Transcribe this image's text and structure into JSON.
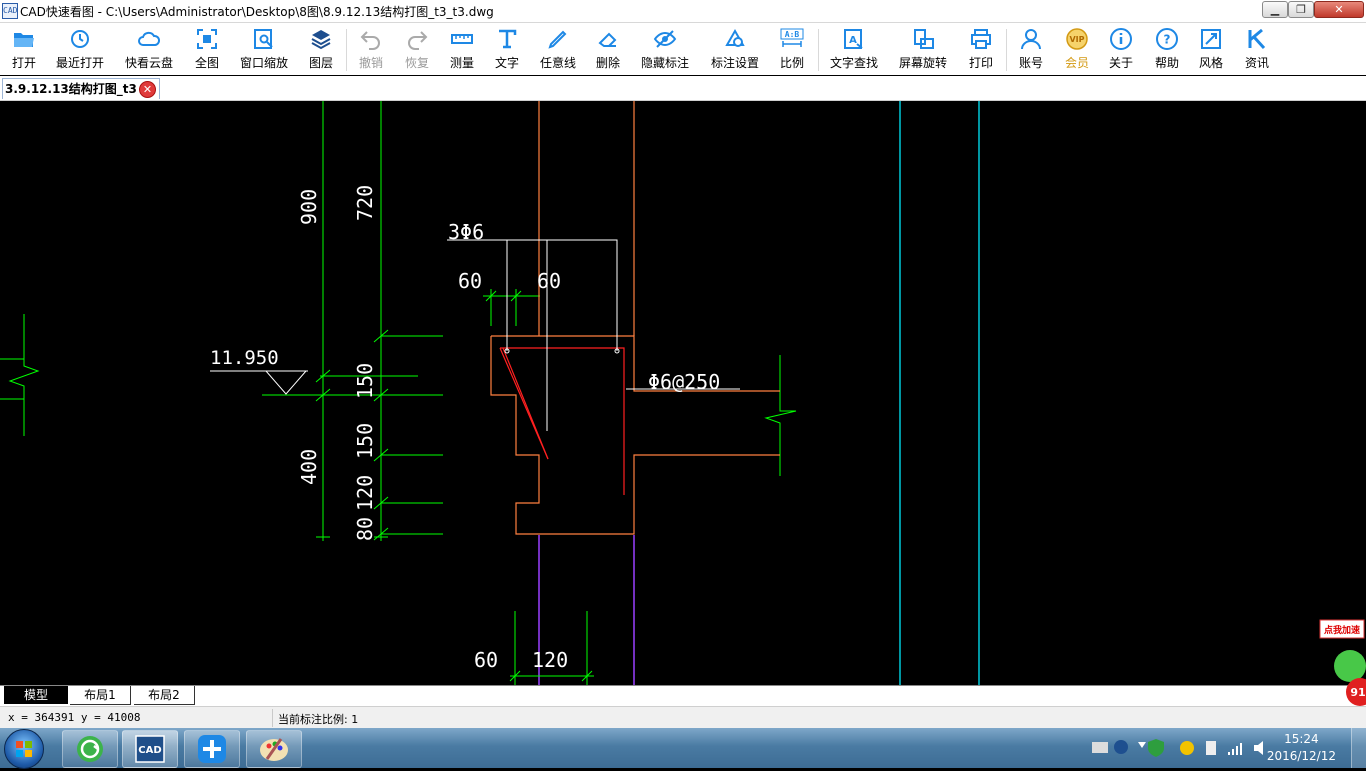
{
  "window": {
    "title": "CAD快速看图 - C:\\Users\\Administrator\\Desktop\\8图\\8.9.12.13结构打图_t3_t3.dwg",
    "app_icon_text": "CAD"
  },
  "toolbar": {
    "items": [
      {
        "label": "打开",
        "icon": "folder-open-icon",
        "enabled": true
      },
      {
        "label": "最近打开",
        "icon": "history-clock-icon",
        "enabled": true
      },
      {
        "label": "快看云盘",
        "icon": "cloud-icon",
        "enabled": true
      },
      {
        "label": "全图",
        "icon": "fit-all-icon",
        "enabled": true
      },
      {
        "label": "窗口缩放",
        "icon": "zoom-window-icon",
        "enabled": true
      },
      {
        "label": "图层",
        "icon": "layers-icon",
        "enabled": true
      },
      {
        "label": "撤销",
        "icon": "undo-icon",
        "enabled": false
      },
      {
        "label": "恢复",
        "icon": "redo-icon",
        "enabled": false
      },
      {
        "label": "测量",
        "icon": "ruler-icon",
        "enabled": true
      },
      {
        "label": "文字",
        "icon": "text-t-icon",
        "enabled": true
      },
      {
        "label": "任意线",
        "icon": "pen-icon",
        "enabled": true
      },
      {
        "label": "删除",
        "icon": "eraser-icon",
        "enabled": true
      },
      {
        "label": "隐藏标注",
        "icon": "eye-hide-icon",
        "enabled": true
      },
      {
        "label": "标注设置",
        "icon": "dimension-settings-icon",
        "enabled": true
      },
      {
        "label": "比例",
        "icon": "scale-ab-icon",
        "enabled": true
      },
      {
        "label": "文字查找",
        "icon": "text-search-icon",
        "enabled": true
      },
      {
        "label": "屏幕旋转",
        "icon": "screen-rotate-icon",
        "enabled": true
      },
      {
        "label": "打印",
        "icon": "printer-icon",
        "enabled": true
      },
      {
        "label": "账号",
        "icon": "user-icon",
        "enabled": true
      },
      {
        "label": "会员",
        "icon": "vip-icon",
        "enabled": true
      },
      {
        "label": "关于",
        "icon": "info-icon",
        "enabled": true
      },
      {
        "label": "帮助",
        "icon": "help-icon",
        "enabled": true
      },
      {
        "label": "风格",
        "icon": "style-icon",
        "enabled": true
      },
      {
        "label": "资讯",
        "icon": "news-k-icon",
        "enabled": true
      }
    ],
    "scale_icon_text": "A:B"
  },
  "doc_tab": {
    "label": "3.9.12.13结构打图_t3"
  },
  "drawing": {
    "texts": {
      "d900": "900",
      "d720": "720",
      "rebar_top": "3Φ6",
      "d60_a": "60",
      "d60_b": "60",
      "elev": "11.950",
      "stirrup": "Φ6@250",
      "d150_a": "150",
      "d150_b": "150",
      "d400": "400",
      "d120_v": "120",
      "d80": "80",
      "d60_bottom": "60",
      "d120_bottom": "120"
    },
    "colors": {
      "dimension": "#00ff00",
      "outline": "#ff8040",
      "rebar": "#ff2020",
      "leader": "#ffffff",
      "axis_cyan": "#00c8d8",
      "axis_purple": "#9a40ff"
    }
  },
  "layout_tabs": [
    "模型",
    "布局1",
    "布局2"
  ],
  "status": {
    "coords": "x = 364391  y = 41008",
    "scale": "当前标注比例: 1"
  },
  "taskbar": {
    "apps": [
      "browser-icon",
      "cad-app-icon",
      "network-app-icon",
      "paint-icon"
    ],
    "cad_task_text": "CAD",
    "time": "15:24",
    "date": "2016/12/12"
  },
  "accelerator": {
    "label": "点我加速",
    "badge": "91"
  }
}
